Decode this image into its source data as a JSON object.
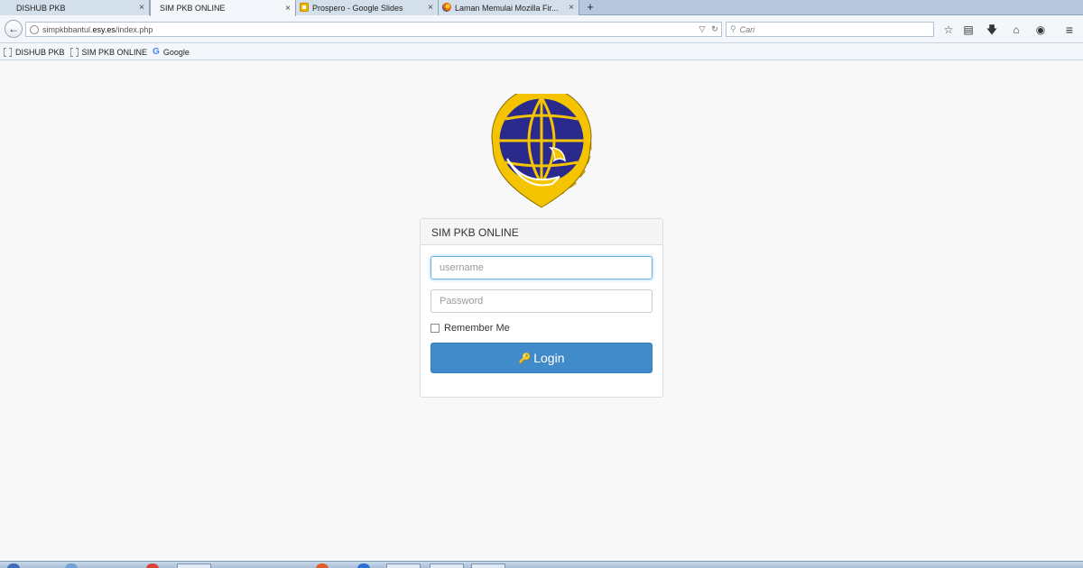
{
  "browser": {
    "tabs": [
      {
        "label": "DISHUB PKB",
        "active": false,
        "icon": "none"
      },
      {
        "label": "SIM PKB ONLINE",
        "active": true,
        "icon": "none"
      },
      {
        "label": "Prospero - Google Slides",
        "active": false,
        "icon": "google-slides-icon"
      },
      {
        "label": "Laman Memulai Mozilla Fir...",
        "active": false,
        "icon": "firefox-icon"
      }
    ],
    "new_tab_label": "+",
    "close_glyph": "×",
    "url_prefix": "simpkbbantul.",
    "url_host": "esy.es",
    "url_path": "/index.php",
    "search_placeholder": "Cari",
    "bookmarks": [
      {
        "label": "DISHUB PKB",
        "icon": "page-icon"
      },
      {
        "label": "SIM PKB ONLINE",
        "icon": "page-icon"
      },
      {
        "label": "Google",
        "icon": "google-icon"
      }
    ]
  },
  "login": {
    "panel_title": "SIM PKB ONLINE",
    "username_placeholder": "username",
    "password_placeholder": "Password",
    "remember_label": "Remember Me",
    "remember_checked": false,
    "login_label": "Login"
  },
  "colors": {
    "logo_navy": "#2a2a8c",
    "logo_gold": "#f5c400",
    "login_button": "#428bca"
  }
}
